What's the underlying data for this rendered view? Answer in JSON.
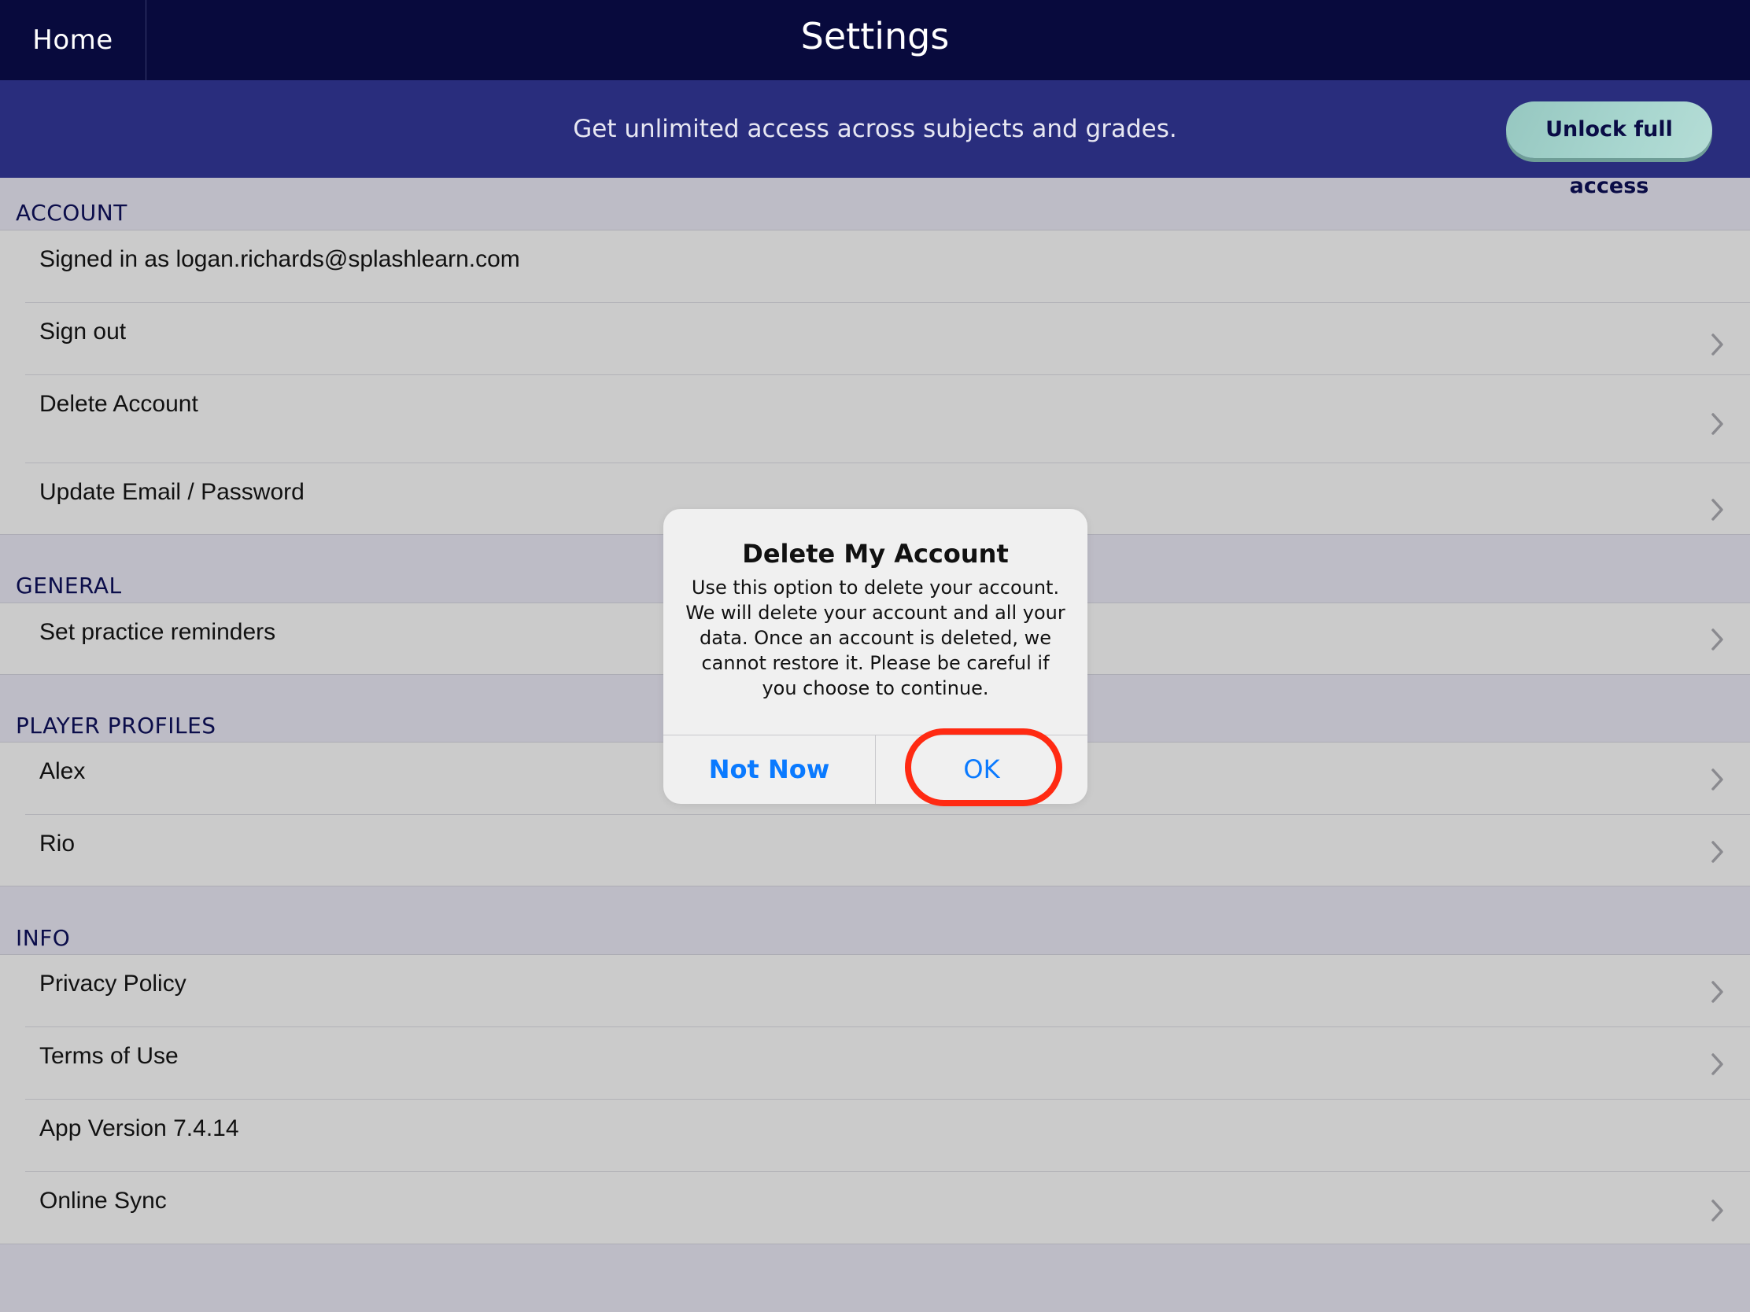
{
  "header": {
    "home_label": "Home",
    "title": "Settings"
  },
  "promo": {
    "text": "Get unlimited access across subjects and grades.",
    "button_label": "Unlock full access"
  },
  "sections": {
    "account": {
      "header": "ACCOUNT",
      "items": [
        {
          "label": "Signed in as logan.richards@splashlearn.com",
          "chevron": false
        },
        {
          "label": "Sign out",
          "chevron": true
        },
        {
          "label": "Delete Account",
          "chevron": true
        },
        {
          "label": "Update Email / Password",
          "chevron": true
        }
      ]
    },
    "general": {
      "header": "GENERAL",
      "items": [
        {
          "label": "Set practice reminders",
          "chevron": true
        }
      ]
    },
    "player_profiles": {
      "header": "PLAYER PROFILES",
      "items": [
        {
          "label": "Alex",
          "chevron": true
        },
        {
          "label": "Rio",
          "chevron": true
        }
      ]
    },
    "info": {
      "header": "INFO",
      "items": [
        {
          "label": "Privacy Policy",
          "chevron": true
        },
        {
          "label": "Terms of Use",
          "chevron": true
        },
        {
          "label": "App Version 7.4.14",
          "chevron": false
        },
        {
          "label": "Online Sync",
          "chevron": true
        }
      ]
    }
  },
  "alert": {
    "title": "Delete My Account",
    "message": "Use this option to delete your account. We will delete your account and all your data. Once an account is deleted, we cannot restore it. Please be careful if you choose to continue.",
    "cancel_label": "Not Now",
    "confirm_label": "OK"
  },
  "colors": {
    "header_bg": "#080a3d",
    "promo_bg": "#292d7d",
    "unlock_bg": "#a8d6cf",
    "alert_button_text": "#0a7aff",
    "highlight": "#ff2a12"
  },
  "icons": {
    "row_chevron": "chevron-right-icon"
  }
}
